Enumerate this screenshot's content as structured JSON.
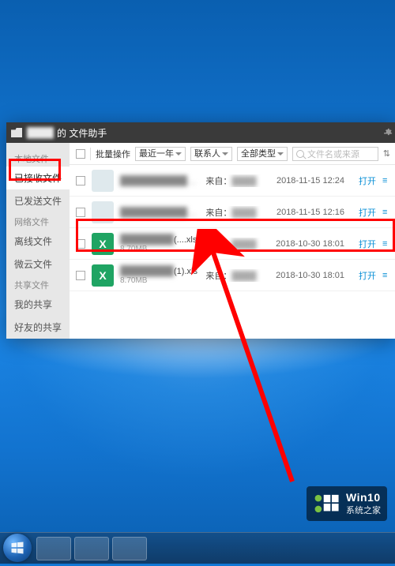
{
  "window": {
    "title_blurred": "████",
    "title_suffix": "的 文件助手"
  },
  "sidebar": {
    "groups": [
      {
        "label": "本地文件",
        "items": [
          {
            "label": "已接收文件",
            "selected": true
          },
          {
            "label": "已发送文件"
          }
        ]
      },
      {
        "label": "网络文件",
        "items": [
          {
            "label": "离线文件"
          },
          {
            "label": "微云文件"
          }
        ]
      },
      {
        "label": "共享文件",
        "gear": true,
        "items": [
          {
            "label": "我的共享"
          },
          {
            "label": "好友的共享"
          }
        ]
      }
    ]
  },
  "toolbar": {
    "batch_label": "批量操作",
    "filters": [
      "最近一年",
      "联系人",
      "全部类型"
    ],
    "search_placeholder": "文件名或来源",
    "extra_glyph": "⇅"
  },
  "files": [
    {
      "thumb": "img",
      "name_blur": "████████████",
      "name_suffix": "",
      "size": "",
      "from": "来自：",
      "from_blur": "████",
      "time": "2018-11-15 12:24",
      "open": "打开"
    },
    {
      "thumb": "img",
      "name_blur": "████████████",
      "name_suffix": "",
      "size": "",
      "from": "来自：",
      "from_blur": "████",
      "time": "2018-11-15 12:16",
      "open": "打开"
    },
    {
      "thumb": "x",
      "name_blur": "████████",
      "name_suffix": "(....xls",
      "size": "8.70MB",
      "from": "来自：",
      "from_blur": "████",
      "time": "2018-10-30 18:01",
      "open": "打开"
    },
    {
      "thumb": "x",
      "name_blur": "████████",
      "name_suffix": "(1).xls",
      "size": "8.70MB",
      "from": "来自：",
      "from_blur": "████",
      "time": "2018-10-30 18:01",
      "open": "打开"
    }
  ],
  "watermark": {
    "title": "Win10",
    "subtitle": "系统之家"
  }
}
